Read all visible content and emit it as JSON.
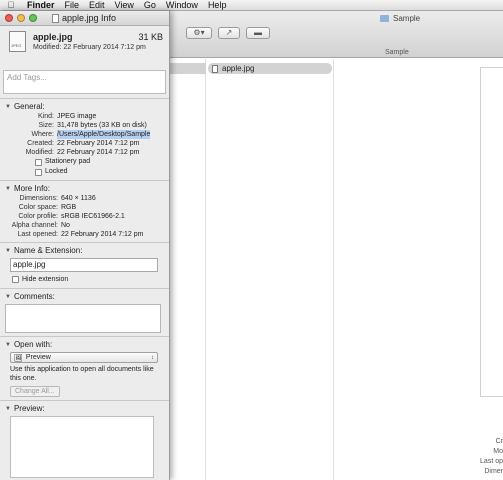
{
  "menubar": {
    "apple": "",
    "items": [
      "Finder",
      "File",
      "Edit",
      "View",
      "Go",
      "Window",
      "Help"
    ]
  },
  "finder": {
    "window_title": "Sample",
    "path_label": "Sample",
    "selected_file": "apple.jpg",
    "preview_info": [
      "Cr",
      "Mo",
      "Last op",
      "Dimer"
    ]
  },
  "info_window": {
    "title": "apple.jpg Info",
    "file_name": "apple.jpg",
    "file_size": "31 KB",
    "modified_line": "Modified: 22 February 2014 7:12 pm",
    "icon_tag": "JPEG",
    "tags_placeholder": "Add Tags...",
    "general": {
      "heading": "General:",
      "rows": [
        {
          "k": "Kind:",
          "v": "JPEG image"
        },
        {
          "k": "Size:",
          "v": "31,478 bytes (33 KB on disk)"
        },
        {
          "k": "Where:",
          "v": "/Users/Apple/Desktop/Sample"
        },
        {
          "k": "Created:",
          "v": "22 February 2014 7:12 pm"
        },
        {
          "k": "Modified:",
          "v": "22 February 2014 7:12 pm"
        }
      ],
      "stationery": "Stationery pad",
      "locked": "Locked"
    },
    "more_info": {
      "heading": "More Info:",
      "rows": [
        {
          "k": "Dimensions:",
          "v": "640 × 1136"
        },
        {
          "k": "Color space:",
          "v": "RGB"
        },
        {
          "k": "Color profile:",
          "v": "sRGB IEC61966-2.1"
        },
        {
          "k": "Alpha channel:",
          "v": "No"
        },
        {
          "k": "Last opened:",
          "v": "22 February 2014 7:12 pm"
        }
      ]
    },
    "name_ext": {
      "heading": "Name & Extension:",
      "value": "apple.jpg",
      "hide_extension": "Hide extension"
    },
    "comments": {
      "heading": "Comments:"
    },
    "open_with": {
      "heading": "Open with:",
      "app": "Preview",
      "note": "Use this application to open all documents like this one.",
      "change_all": "Change All..."
    },
    "preview": {
      "heading": "Preview:"
    }
  }
}
